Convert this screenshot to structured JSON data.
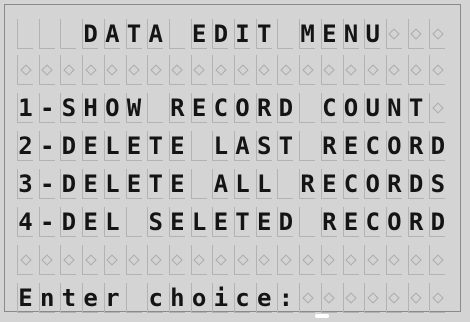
{
  "title": "DATA EDIT MENU",
  "options": [
    "1-SHOW RECORD COUNT",
    "2-DELETE LAST RECORD",
    "3-DELETE ALL RECORDS",
    "4-DEL SELETED RECORD"
  ],
  "prompt": "Enter choice:",
  "input_value": ""
}
